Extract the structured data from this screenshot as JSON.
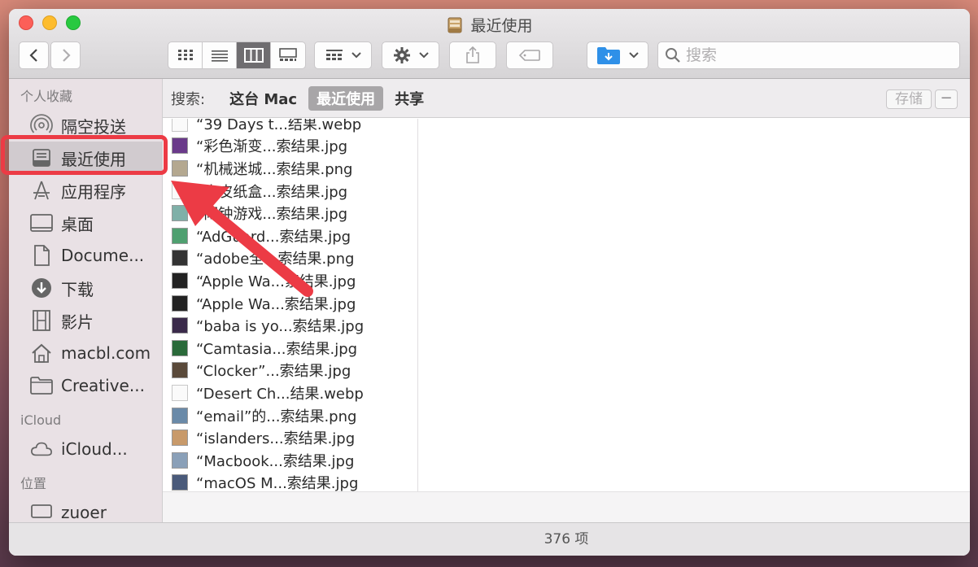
{
  "window": {
    "title": "最近使用"
  },
  "toolbar": {
    "back_label": "<",
    "forward_label": ">",
    "search_placeholder": "搜索"
  },
  "sidebar": {
    "sections": [
      {
        "header": "个人收藏",
        "items": [
          {
            "label": "隔空投送",
            "icon": "airdrop-icon"
          },
          {
            "label": "最近使用",
            "icon": "recents-icon",
            "selected": true
          },
          {
            "label": "应用程序",
            "icon": "applications-icon"
          },
          {
            "label": "桌面",
            "icon": "desktop-icon"
          },
          {
            "label": "Docume...",
            "icon": "document-icon"
          },
          {
            "label": "下载",
            "icon": "download-icon"
          },
          {
            "label": "影片",
            "icon": "film-icon"
          },
          {
            "label": "macbl.com",
            "icon": "home-icon"
          },
          {
            "label": "Creative...",
            "icon": "folder-icon"
          }
        ]
      },
      {
        "header": "iCloud",
        "items": [
          {
            "label": "iCloud...",
            "icon": "cloud-icon"
          }
        ]
      },
      {
        "header": "位置",
        "items": [
          {
            "label": "zuoer",
            "icon": "computer-icon"
          }
        ]
      }
    ]
  },
  "scopebar": {
    "label": "搜索:",
    "options": [
      "这台 Mac",
      "最近使用",
      "共享"
    ],
    "active": "最近使用",
    "save_label": "存储",
    "minus_label": "−"
  },
  "files": [
    {
      "name": "“39 Days t...结果.webp",
      "thumb": "blank"
    },
    {
      "name": "“彩色渐变...索结果.jpg",
      "thumb": "#6a3a8a"
    },
    {
      "name": "“机械迷城...索结果.png",
      "thumb": "#b4a890"
    },
    {
      "name": "“牛皮纸盒...索结果.jpg",
      "thumb": "blank"
    },
    {
      "name": "“闹钟游戏...索结果.jpg",
      "thumb": "#7fb0a8"
    },
    {
      "name": "“AdGuard...索结果.jpg",
      "thumb": "#4fa070"
    },
    {
      "name": "“adobe全...索结果.png",
      "thumb": "#333333"
    },
    {
      "name": "“Apple Wa...索结果.jpg",
      "thumb": "#222222"
    },
    {
      "name": "“Apple Wa...索结果.jpg",
      "thumb": "#222222"
    },
    {
      "name": "“baba is yo...索结果.jpg",
      "thumb": "#3a2a4a"
    },
    {
      "name": "“Camtasia...索结果.jpg",
      "thumb": "#2a6a3a"
    },
    {
      "name": "“Clocker”...索结果.jpg",
      "thumb": "#5a4a3a"
    },
    {
      "name": "“Desert Ch...结果.webp",
      "thumb": "blank"
    },
    {
      "name": "“email”的...索结果.png",
      "thumb": "#6a8aa8"
    },
    {
      "name": "“islanders...索结果.jpg",
      "thumb": "#c89a6a"
    },
    {
      "name": "“Macbook...索结果.jpg",
      "thumb": "#8aa0b8"
    },
    {
      "name": "“macOS M...索结果.jpg",
      "thumb": "#4a5a7a"
    }
  ],
  "status": {
    "count_text": "376 项"
  },
  "colors": {
    "annotation_red": "#ec3b45",
    "window_bg": "#f2f1f2"
  }
}
